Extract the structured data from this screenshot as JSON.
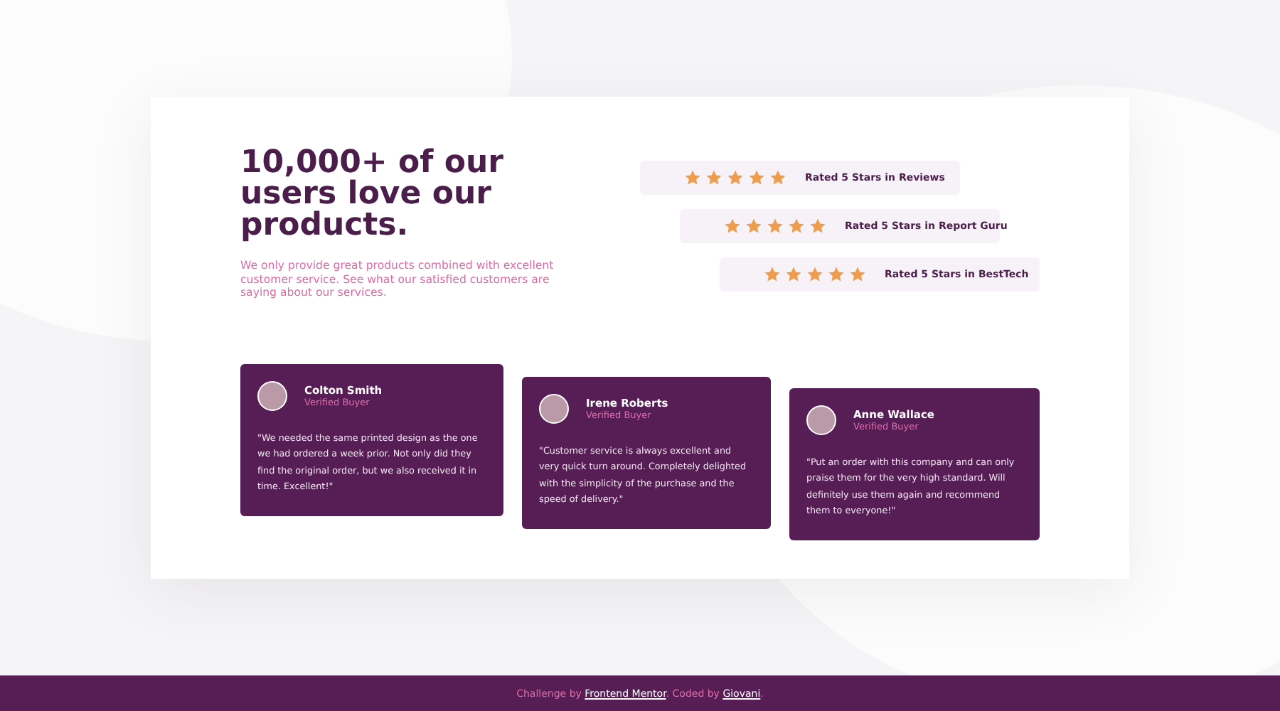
{
  "hero": {
    "title": "10,000+ of our users love our products.",
    "description": "We only provide great products combined with excellent customer service. See what our satisfied customers are saying about our services."
  },
  "ratings": [
    {
      "stars": 5,
      "label": "Rated 5 Stars in Reviews"
    },
    {
      "stars": 5,
      "label": "Rated 5 Stars in Report Guru"
    },
    {
      "stars": 5,
      "label": "Rated 5 Stars in BestTech"
    }
  ],
  "testimonials": [
    {
      "name": "Colton Smith",
      "role": "Verified Buyer",
      "quote": "\"We needed the same printed design as the one we had ordered a week prior. Not only did they find the original order, but we also received it in time. Excellent!\""
    },
    {
      "name": "Irene Roberts",
      "role": "Verified Buyer",
      "quote": "\"Customer service is always excellent and very quick turn around. Completely delighted with the simplicity of the purchase and the speed of delivery.\""
    },
    {
      "name": "Anne Wallace",
      "role": "Verified Buyer",
      "quote": "\"Put an order with this company and can only praise them for the very high standard. Will definitely use them again and recommend them to everyone!\""
    }
  ],
  "footer": {
    "prefix": "Challenge by",
    "link_1": "Frontend Mentor",
    "middle": ". Coded by",
    "link_2": "Giovani",
    "suffix": "."
  }
}
